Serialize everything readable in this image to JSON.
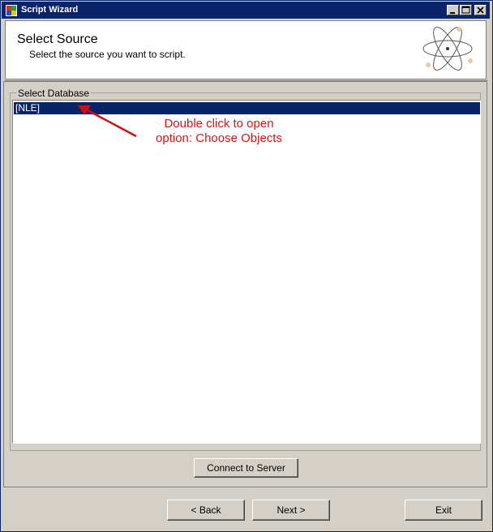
{
  "window": {
    "title": "Script Wizard",
    "title_icon": "app-icon",
    "controls": [
      "minimize-icon",
      "maximize-icon",
      "close-icon"
    ]
  },
  "header": {
    "title": "Select Source",
    "subtitle": "Select the source you want to script.",
    "graphic": "atom-icon"
  },
  "database_group": {
    "legend": "Select Database",
    "items": [
      {
        "label": "[NLE]",
        "selected": true
      }
    ]
  },
  "annotation": {
    "line1": "Double click to open",
    "line2": "option: Choose Objects",
    "color": "#dd1111"
  },
  "buttons": {
    "connect": "Connect to Server",
    "back": "< Back",
    "next": "Next >",
    "exit": "Exit"
  },
  "colors": {
    "titlebar": "#0a246a",
    "selection": "#0a246a",
    "face": "#d4d0c8"
  }
}
